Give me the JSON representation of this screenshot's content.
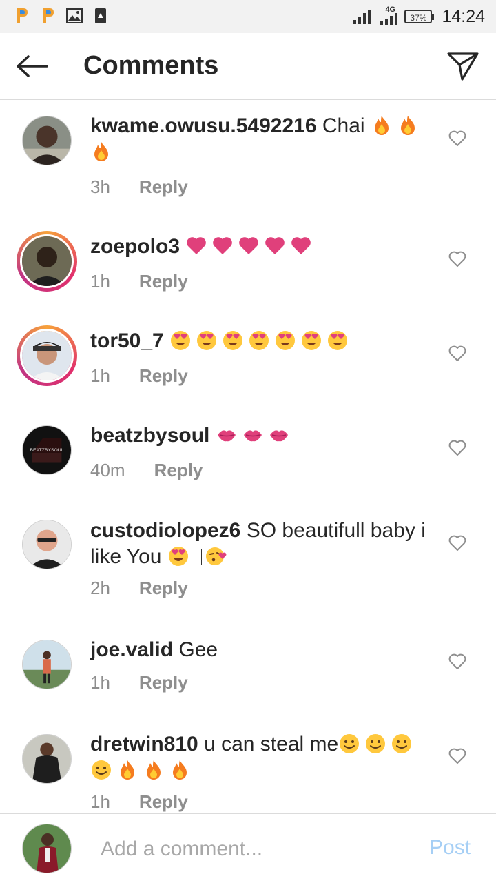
{
  "status_bar": {
    "icons": [
      "app-p-icon",
      "app-p-icon",
      "gallery-icon",
      "download-icon"
    ],
    "network": "4G",
    "battery": "37%",
    "time": "14:24"
  },
  "header": {
    "title": "Comments",
    "back_icon": "arrow-left-icon",
    "send_icon": "paper-plane-icon"
  },
  "comments": [
    {
      "username": "kwame.owusu.5492216",
      "text": "Chai",
      "emojis": [
        "fire",
        "fire",
        "fire"
      ],
      "time": "3h",
      "reply": "Reply"
    },
    {
      "username": "zoepolo3",
      "text": "",
      "emojis": [
        "heart",
        "heart",
        "heart",
        "heart",
        "heart"
      ],
      "time": "1h",
      "reply": "Reply"
    },
    {
      "username": "tor50_7",
      "text": "",
      "emojis": [
        "heart-eyes",
        "heart-eyes",
        "heart-eyes",
        "heart-eyes",
        "heart-eyes",
        "heart-eyes",
        "heart-eyes"
      ],
      "time": "1h",
      "reply": "Reply"
    },
    {
      "username": "beatzbysoul",
      "text": "",
      "emojis": [
        "kiss-lips",
        "kiss-lips",
        "kiss-lips"
      ],
      "time": "40m",
      "reply": "Reply",
      "avatar_text": "BEATZBYSOUL"
    },
    {
      "username": "custodiolopez6",
      "text": "SO beautifull baby i like You",
      "emojis": [
        "heart-eyes",
        "missing-glyph",
        "kissing-heart"
      ],
      "time": "2h",
      "reply": "Reply"
    },
    {
      "username": "joe.valid",
      "text": "Gee",
      "emojis": [],
      "time": "1h",
      "reply": "Reply"
    },
    {
      "username": "dretwin810",
      "text": "u can steal me",
      "emojis": [
        "smile",
        "smile",
        "smile",
        "smile",
        "fire",
        "fire",
        "fire"
      ],
      "time": "1h",
      "reply": "Reply"
    }
  ],
  "input": {
    "placeholder": "Add a comment...",
    "post_label": "Post"
  },
  "colors": {
    "text": "#262626",
    "secondary": "#8e8e8e",
    "divider": "#dbdbdb",
    "post_disabled": "#a6cff5",
    "heart": "#e0407b",
    "story_ring": "#e1306c"
  }
}
